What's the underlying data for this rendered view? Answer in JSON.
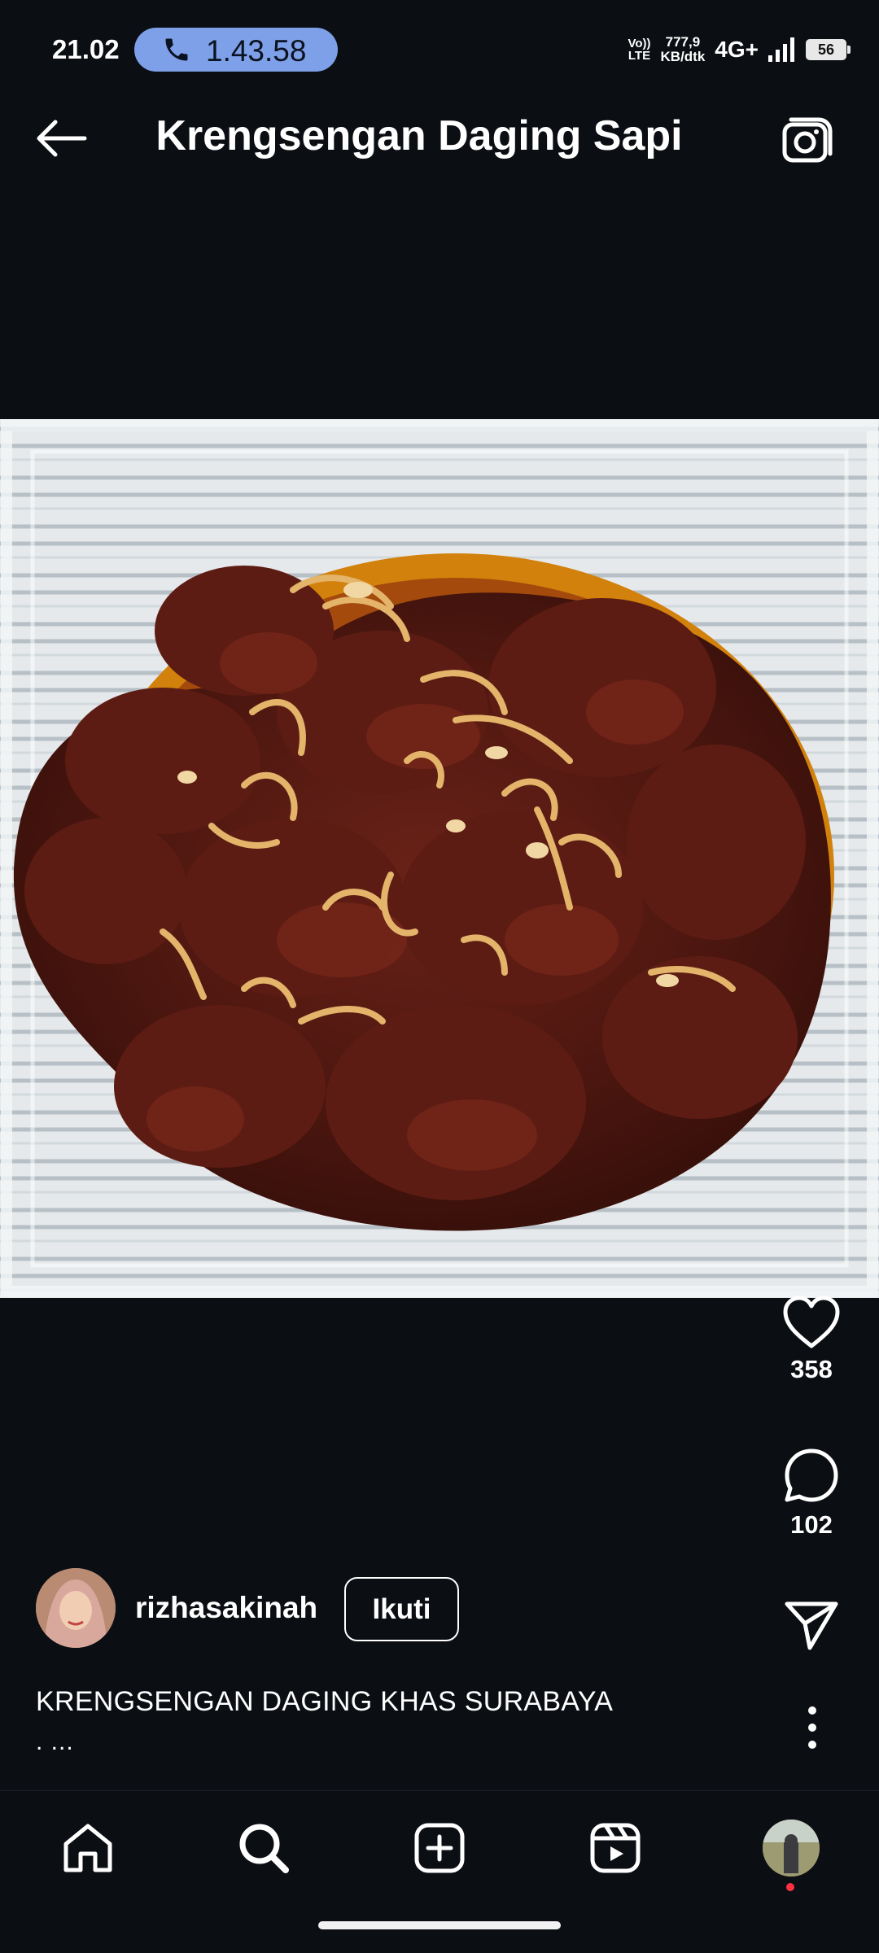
{
  "status_bar": {
    "time": "21.02",
    "call_timer": "1.43.58",
    "volte_line1": "Vo))",
    "volte_line2": "LTE",
    "speed_value": "777,9",
    "speed_unit": "KB/dtk",
    "network": "4G+",
    "battery": "56"
  },
  "header": {
    "title": "Krengsengan Daging Sapi",
    "back_icon": "arrow-left-icon",
    "camera_icon": "camera-icon"
  },
  "post": {
    "image_subject": "beef-krengsengan-photo",
    "likes": "358",
    "comments": "102",
    "author": "rizhasakinah",
    "follow_label": "Ikuti",
    "caption": "KRENGSENGAN DAGING KHAS SURABAYA",
    "caption_more": ". ..."
  },
  "bottom_nav": {
    "items": [
      "home-icon",
      "search-icon",
      "create-icon",
      "reels-icon",
      "profile-avatar"
    ]
  },
  "colors": {
    "background": "#0b0e13",
    "call_pill": "#7ea0e8",
    "notification_dot": "#ff3040"
  }
}
